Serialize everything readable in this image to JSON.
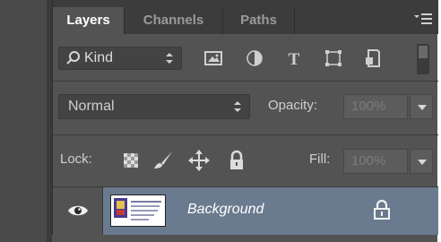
{
  "tabs": [
    {
      "label": "Layers",
      "active": true
    },
    {
      "label": "Channels",
      "active": false
    },
    {
      "label": "Paths",
      "active": false
    }
  ],
  "panel_menu_icon": "hamburger-menu-icon",
  "filter": {
    "kind_label": "Kind",
    "icons": [
      "image-filter-icon",
      "adjustment-filter-icon",
      "type-filter-icon",
      "shape-filter-icon",
      "smart-object-filter-icon"
    ]
  },
  "blend": {
    "mode": "Normal",
    "opacity_label": "Opacity:",
    "opacity_value": "100%"
  },
  "lock": {
    "label": "Lock:",
    "icons": [
      "lock-transparent-pixels-icon",
      "lock-image-pixels-icon",
      "lock-position-icon",
      "lock-all-icon"
    ],
    "fill_label": "Fill:",
    "fill_value": "100%"
  },
  "layers": [
    {
      "name": "Background",
      "visible": true,
      "locked": true,
      "selected": true
    }
  ],
  "colors": {
    "panel_bg": "#535353",
    "tabbar_bg": "#3c3c3c",
    "selected_row": "#6b7b8f"
  }
}
